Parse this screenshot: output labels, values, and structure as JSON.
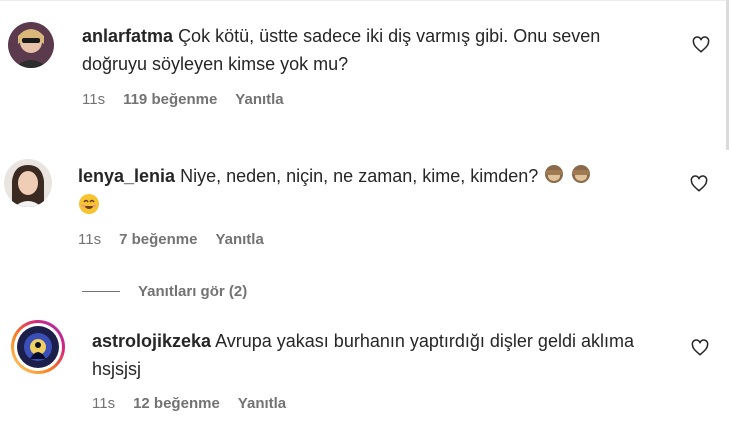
{
  "comments": [
    {
      "username": "anlarfatma",
      "text": "Çok kötü, üstte sadece iki diş varmış gibi. Onu seven doğruyu söyleyen kimse yok mu?",
      "time": "11s",
      "likes": "119 beğenme",
      "reply": "Yanıtla",
      "avatar_icon": "avatar-photo"
    },
    {
      "username": "lenya_lenia",
      "text": "Niye, neden, niçin, ne zaman, kime, kimden?",
      "emojis": [
        "see-no-evil-monkey",
        "see-no-evil-monkey",
        "smiling-face"
      ],
      "time": "11s",
      "likes": "7 beğenme",
      "reply": "Yanıtla",
      "avatar_icon": "avatar-photo"
    },
    {
      "username": "astrolojikzeka",
      "text": "Avrupa yakası burhanın yaptırdığı dişler geldi aklıma hsjsjsj",
      "time": "11s",
      "likes": "12 beğenme",
      "reply": "Yanıtla",
      "avatar_icon": "avatar-story-ring"
    }
  ],
  "view_replies": "Yanıtları gör (2)",
  "colors": {
    "text": "#262626",
    "meta": "#737373",
    "story_ring": "#d62976"
  }
}
